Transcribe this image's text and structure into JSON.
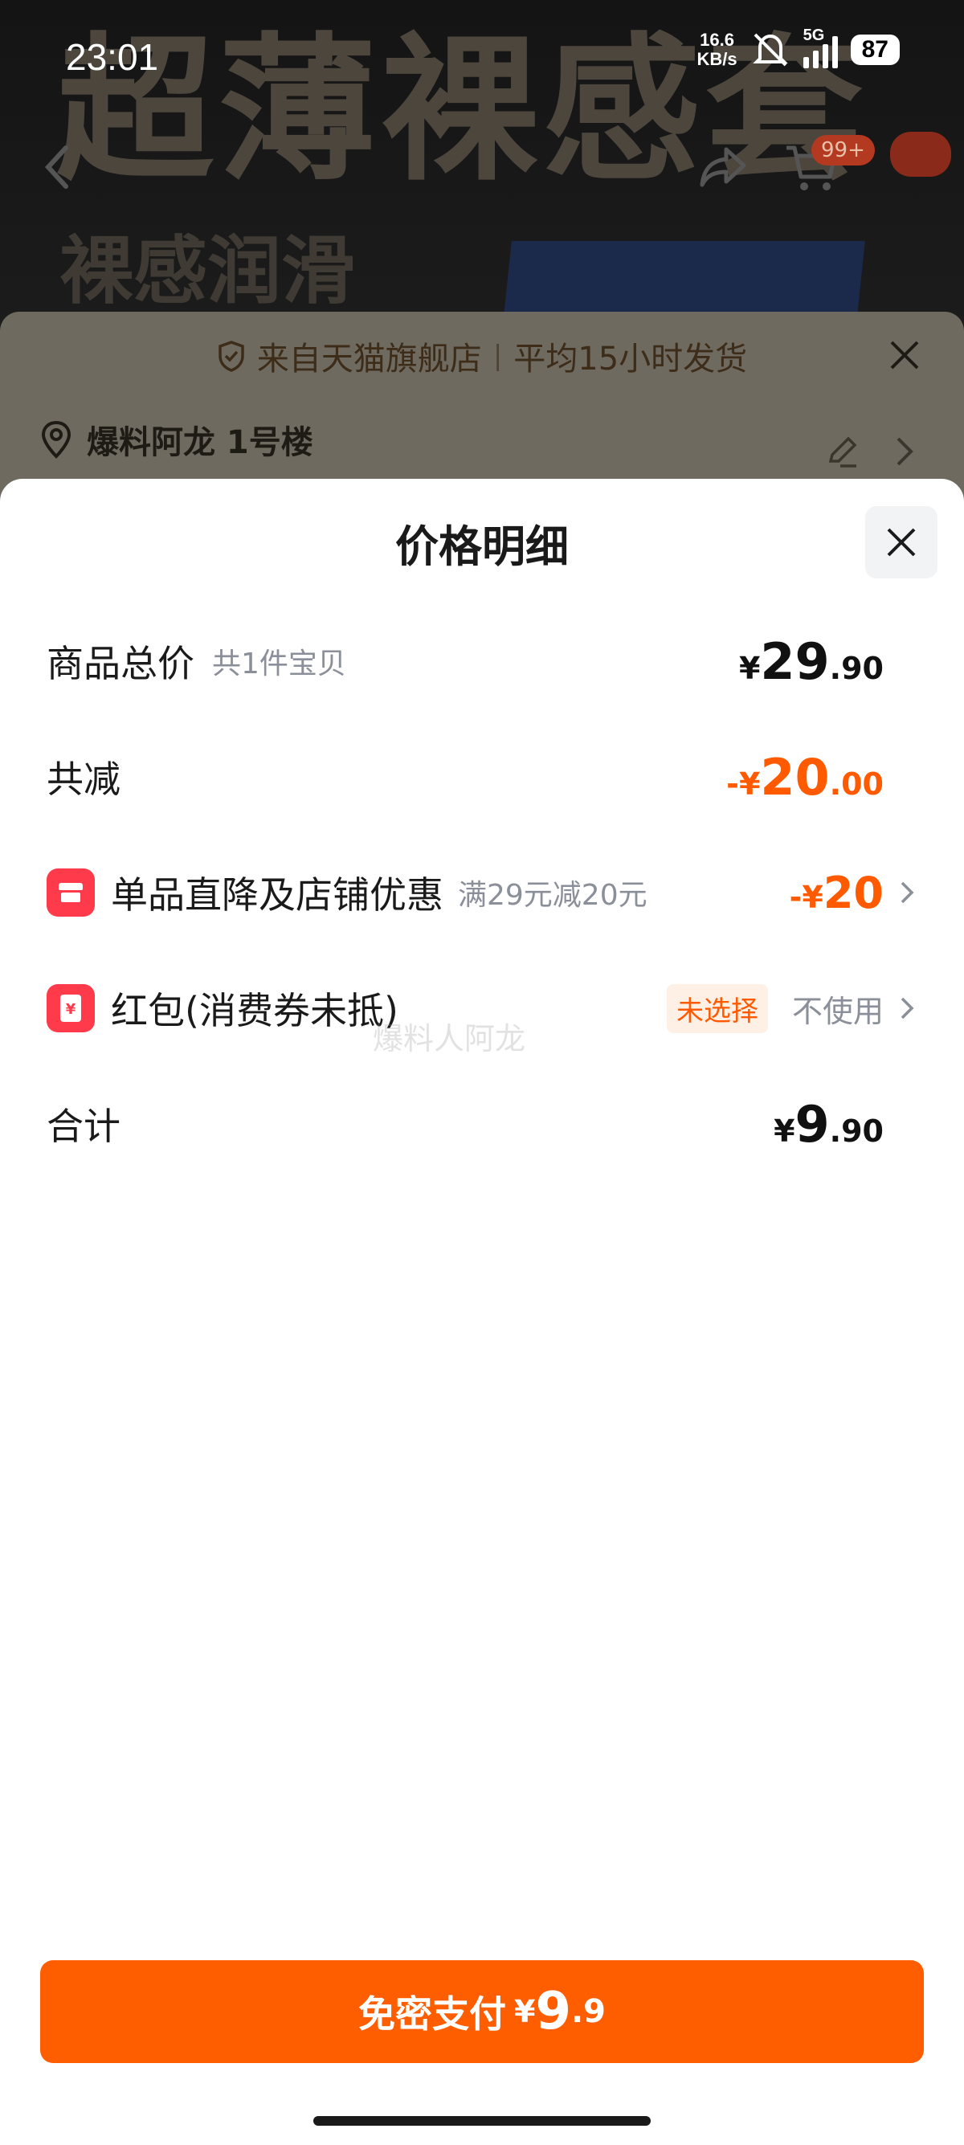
{
  "status_bar": {
    "time": "23:01",
    "net_speed_value": "16.6",
    "net_speed_unit": "KB/s",
    "network": "5G",
    "battery": "87"
  },
  "background": {
    "banner_title": "超薄裸感套",
    "banner_subtitle": "裸感润滑",
    "cart_badge": "99+",
    "notice_store": "来自天猫旗舰店",
    "notice_separator": "|",
    "notice_shipping": "平均15小时发货",
    "address": "爆料阿龙 1号楼"
  },
  "sheet": {
    "title": "价格明细",
    "rows": {
      "total": {
        "label": "商品总价",
        "sub": "共1件宝贝",
        "symbol": "¥",
        "int": "29",
        "dec": ".90"
      },
      "reduction": {
        "label": "共减",
        "symbol": "-¥",
        "int": "20",
        "dec": ".00"
      },
      "discount": {
        "label": "单品直降及店铺优惠",
        "sub": "满29元减20元",
        "symbol": "-¥",
        "int": "20"
      },
      "red_packet": {
        "label": "红包(消费券未抵)",
        "tag": "未选择",
        "value": "不使用"
      },
      "sum": {
        "label": "合计",
        "symbol": "¥",
        "int": "9",
        "dec": ".90"
      }
    },
    "watermark": "爆料人阿龙"
  },
  "pay_button": {
    "label": "免密支付",
    "symbol": "¥",
    "int": "9",
    "dec": ".9"
  },
  "colors": {
    "accent": "#ff5e00",
    "discount": "#ff5a00",
    "icon_red": "#ff3a4a"
  }
}
